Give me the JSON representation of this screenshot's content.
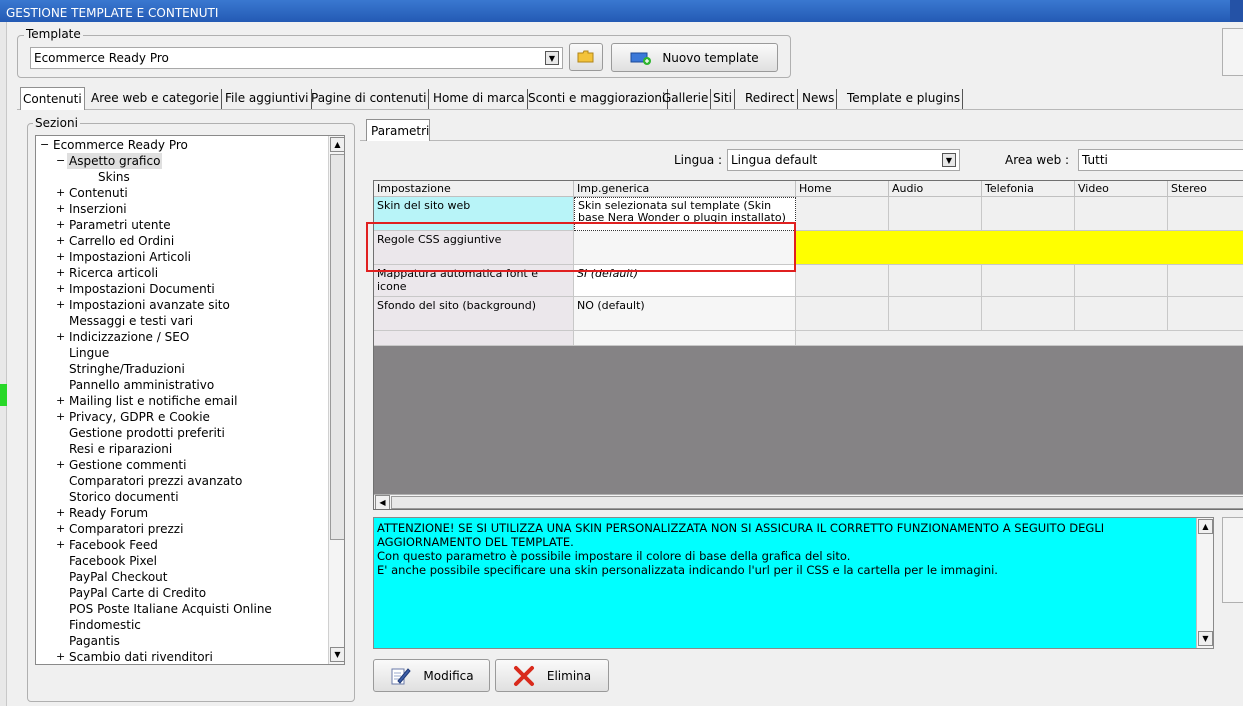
{
  "window": {
    "title": "GESTIONE TEMPLATE E CONTENUTI"
  },
  "template_group": {
    "legend": "Template",
    "selected": "Ecommerce Ready Pro",
    "new_button": "Nuovo template"
  },
  "tabs": [
    "Contenuti",
    "Aree web e categorie",
    "File aggiuntivi",
    "Pagine di contenuti",
    "Home di marca",
    "Sconti e maggiorazioni",
    "Gallerie",
    "Siti",
    "Redirect",
    "News",
    "Template e plugins"
  ],
  "sections": {
    "legend": "Sezioni",
    "root": "Ecommerce Ready Pro",
    "items": [
      {
        "label": "Aspetto grafico",
        "expander": "−"
      },
      {
        "label": "Skins",
        "expander": ""
      },
      {
        "label": "Contenuti",
        "expander": "+"
      },
      {
        "label": "Inserzioni",
        "expander": "+"
      },
      {
        "label": "Parametri utente",
        "expander": "+"
      },
      {
        "label": "Carrello ed Ordini",
        "expander": "+"
      },
      {
        "label": "Impostazioni Articoli",
        "expander": "+"
      },
      {
        "label": "Ricerca articoli",
        "expander": "+"
      },
      {
        "label": "Impostazioni Documenti",
        "expander": "+"
      },
      {
        "label": "Impostazioni avanzate sito",
        "expander": "+"
      },
      {
        "label": "Messaggi e testi vari",
        "expander": ""
      },
      {
        "label": "Indicizzazione / SEO",
        "expander": "+"
      },
      {
        "label": "Lingue",
        "expander": ""
      },
      {
        "label": "Stringhe/Traduzioni",
        "expander": ""
      },
      {
        "label": "Pannello amministrativo",
        "expander": ""
      },
      {
        "label": "Mailing list e notifiche email",
        "expander": "+"
      },
      {
        "label": "Privacy, GDPR e Cookie",
        "expander": "+"
      },
      {
        "label": "Gestione prodotti preferiti",
        "expander": ""
      },
      {
        "label": "Resi e riparazioni",
        "expander": ""
      },
      {
        "label": "Gestione commenti",
        "expander": "+"
      },
      {
        "label": "Comparatori prezzi avanzato",
        "expander": ""
      },
      {
        "label": "Storico documenti",
        "expander": ""
      },
      {
        "label": "Ready Forum",
        "expander": "+"
      },
      {
        "label": "Comparatori prezzi",
        "expander": "+"
      },
      {
        "label": "Facebook Feed",
        "expander": "+"
      },
      {
        "label": "Facebook Pixel",
        "expander": ""
      },
      {
        "label": "PayPal Checkout",
        "expander": ""
      },
      {
        "label": "PayPal Carte di Credito",
        "expander": ""
      },
      {
        "label": "POS Poste Italiane Acquisti Online",
        "expander": ""
      },
      {
        "label": "Findomestic",
        "expander": ""
      },
      {
        "label": "Pagantis",
        "expander": ""
      },
      {
        "label": "Scambio dati rivenditori",
        "expander": "+"
      }
    ]
  },
  "params": {
    "tab": "Parametri",
    "lingua_label": "Lingua :",
    "lingua_value": "Lingua default",
    "area_label": "Area web :",
    "area_value": "Tutti",
    "columns": [
      "Impostazione",
      "Imp.generica",
      "Home",
      "Audio",
      "Telefonia",
      "Video",
      "Stereo"
    ],
    "rows": [
      {
        "name": "Skin del sito web",
        "value": "Skin selezionata sul template (Skin base Nera Wonder o plugin installato)"
      },
      {
        "name": "Regole CSS aggiuntive",
        "value": ""
      },
      {
        "name": "Mappatura automatica font e icone",
        "value": "SI (default)"
      },
      {
        "name": "Sfondo del sito (background)",
        "value": "NO (default)"
      }
    ]
  },
  "info_text": {
    "line1": "ATTENZIONE! SE SI UTILIZZA UNA SKIN PERSONALIZZATA NON SI ASSICURA IL CORRETTO FUNZIONAMENTO A SEGUITO DEGLI AGGIORNAMENTO DEL TEMPLATE.",
    "line2": "Con questo parametro è possibile impostare il colore di base della grafica del sito.",
    "line3": "E' anche possibile specificare una skin personalizzata indicando l'url per il CSS e la cartella per le immagini."
  },
  "actions": {
    "edit": "Modifica",
    "delete": "Elimina"
  },
  "colors": {
    "highlight_row": "#ffff00",
    "info_bg": "#00ffff",
    "selected_skin_cell": "#b8f4f8",
    "annotation": "#e02020"
  }
}
